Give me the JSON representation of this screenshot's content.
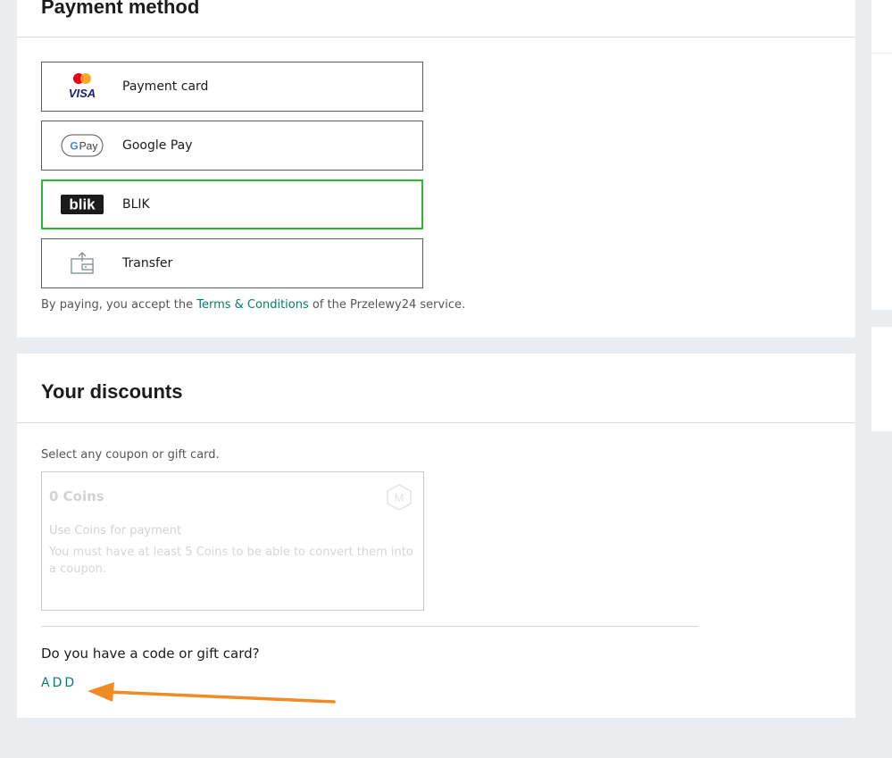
{
  "payment": {
    "title": "Payment method",
    "options": [
      {
        "label": "Payment card",
        "icon": "mastercard-visa-icon",
        "selected": false
      },
      {
        "label": "Google Pay",
        "icon": "google-pay-icon",
        "selected": false
      },
      {
        "label": "BLIK",
        "icon": "blik-icon",
        "selected": true
      },
      {
        "label": "Transfer",
        "icon": "bank-transfer-icon",
        "selected": false
      }
    ],
    "terms_prefix": "By paying, you accept the ",
    "terms_link": "Terms & Conditions",
    "terms_suffix": " of the Przelewy24 service.",
    "logos": {
      "visa": "VISA",
      "gpay_g": "G",
      "gpay_pay": "Pay",
      "blik": "blik"
    }
  },
  "discounts": {
    "title": "Your discounts",
    "hint": "Select any coupon or gift card.",
    "coins": {
      "title": "0 Coins",
      "subtitle": "Use Coins for payment",
      "description": "You must have at least 5 Coins to be able to convert them into a coupon.",
      "icon_letter": "M"
    },
    "code_question": "Do you have a code or gift card?",
    "add_label": "ADD"
  },
  "colors": {
    "accent": "#0a7a6a",
    "selected_border": "#2fb52f",
    "annotation_arrow": "#f08a24",
    "page_bg": "#e9edf0"
  }
}
